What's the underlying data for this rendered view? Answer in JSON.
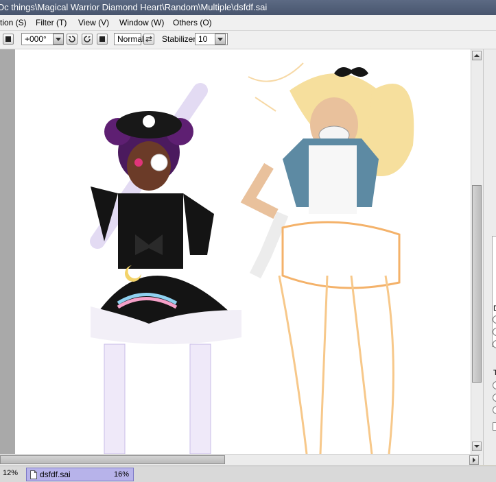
{
  "window": {
    "title": "Oc things\\Magical Warrior Diamond Heart\\Random\\Multiple\\dsfdf.sai"
  },
  "menu": [
    {
      "label": "tion (S)"
    },
    {
      "label": "Filter (T)"
    },
    {
      "label": "View (V)"
    },
    {
      "label": "Window (W)"
    },
    {
      "label": "Others (O)"
    }
  ],
  "toolbar": {
    "rotation_value": "+000°",
    "blend_mode": "Normal",
    "stabilizer_label": "Stabilizer",
    "stabilizer_value": "10"
  },
  "statusbar": {
    "zoom_left": "12%",
    "doc_name": "dsfdf.sai",
    "doc_zoom": "16%"
  },
  "right_panel": {
    "letters": [
      "D",
      "T"
    ]
  }
}
